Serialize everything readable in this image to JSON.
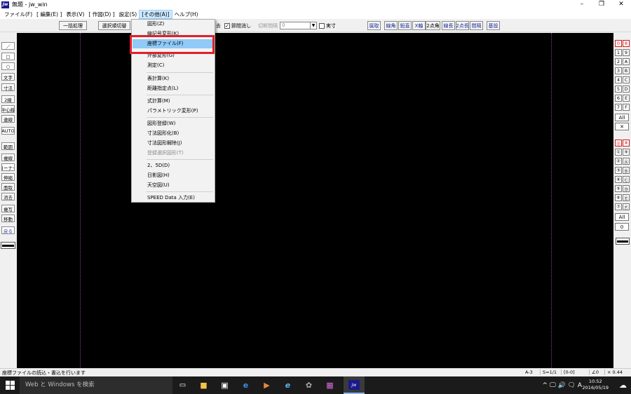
{
  "window": {
    "app_icon_text": "Jw",
    "title": "無題 - jw_win",
    "controls": {
      "minimize": "–",
      "maximize": "❐",
      "close": "✕"
    }
  },
  "menubar": [
    "ファイル(F)",
    "[ 編集(E) ]",
    "表示(V)",
    "[ 作図(D) ]",
    "設定(S)",
    "[その他(A)]",
    "ヘルプ(H)"
  ],
  "menubar_active_index": 5,
  "toolbar": {
    "batch": "一括処理",
    "select_order": "選択順切替",
    "erase_suffix": "去",
    "node_erase": "節間消し",
    "cut_interval": "切断間隔",
    "cut_value": "0",
    "dotted": "実寸",
    "right_buttons": [
      "属取",
      "線角",
      "鉛直",
      "X軸",
      "2点角",
      "線長",
      "2点長",
      "間隔",
      "基設"
    ],
    "right_buttons_blue": [
      true,
      true,
      true,
      true,
      false,
      true,
      true,
      true,
      true
    ]
  },
  "left_tools": [
    "／",
    "□",
    "○",
    "文字",
    "寸法",
    "2線",
    "中心線",
    "連線",
    "AUTO",
    "範囲",
    "複線",
    "コーナー",
    "伸縮",
    "面取",
    "消去",
    "複写",
    "移動",
    "戻る"
  ],
  "right_tools": {
    "layer_groups_top": [
      [
        "0",
        "8"
      ],
      [
        "1",
        "9"
      ],
      [
        "2",
        "A"
      ],
      [
        "3",
        "B"
      ],
      [
        "4",
        "C"
      ],
      [
        "5",
        "D"
      ],
      [
        "6",
        "E"
      ],
      [
        "7",
        "F"
      ]
    ],
    "all_top": "All",
    "cross": "✕",
    "layer_groups_bottom": [
      [
        "⓪",
        "⑧"
      ],
      [
        "①",
        "⑨"
      ],
      [
        "②",
        "Ⓐ"
      ],
      [
        "③",
        "Ⓑ"
      ],
      [
        "④",
        "Ⓒ"
      ],
      [
        "⑤",
        "Ⓓ"
      ],
      [
        "⑥",
        "Ⓔ"
      ],
      [
        "⑦",
        "Ⓕ"
      ]
    ],
    "all_bottom": "All",
    "zero": "0"
  },
  "dropdown": [
    {
      "label": "図形(Z)",
      "disabled": false
    },
    {
      "label": "線記号変形(K)",
      "disabled": false
    },
    {
      "label": "座標ファイル(F)",
      "disabled": false,
      "highlighted": true
    },
    {
      "label": "外部変形(G)",
      "disabled": false
    },
    {
      "label": "測定(C)",
      "disabled": false
    },
    {
      "label": "表計算(K)",
      "disabled": false
    },
    {
      "label": "距離指定点(L)",
      "disabled": false
    },
    {
      "label": "式計算(M)",
      "disabled": false
    },
    {
      "label": "パラメトリック変形(P)",
      "disabled": false
    },
    {
      "label": "図形登録(W)",
      "disabled": false
    },
    {
      "label": "寸法図形化(B)",
      "disabled": false
    },
    {
      "label": "寸法図形解除(J)",
      "disabled": false
    },
    {
      "label": "登録選択図形(T)",
      "disabled": true
    },
    {
      "label": "2、5D(D)",
      "disabled": false
    },
    {
      "label": "日影図(H)",
      "disabled": false
    },
    {
      "label": "天空図(U)",
      "disabled": false
    },
    {
      "label": "SPEED Data 入力(E)",
      "disabled": false
    }
  ],
  "status": {
    "message": "座標ファイルの読込・書込を行います",
    "paper": "A-3",
    "scale": "S=1/1",
    "layer": "[0-0]",
    "angle": "∠0",
    "zoom": "× 0.44"
  },
  "taskbar": {
    "search_placeholder": "Web と Windows を検索",
    "tray_text": "^ 🖵 🔊 🗨 A",
    "time": "10:52",
    "date": "2016/05/19",
    "notif": "☁"
  },
  "colors": {
    "canvas": "#000000",
    "highlight": "#91c9f7",
    "callout": "#e0202a",
    "layer_red": "#d01818"
  }
}
